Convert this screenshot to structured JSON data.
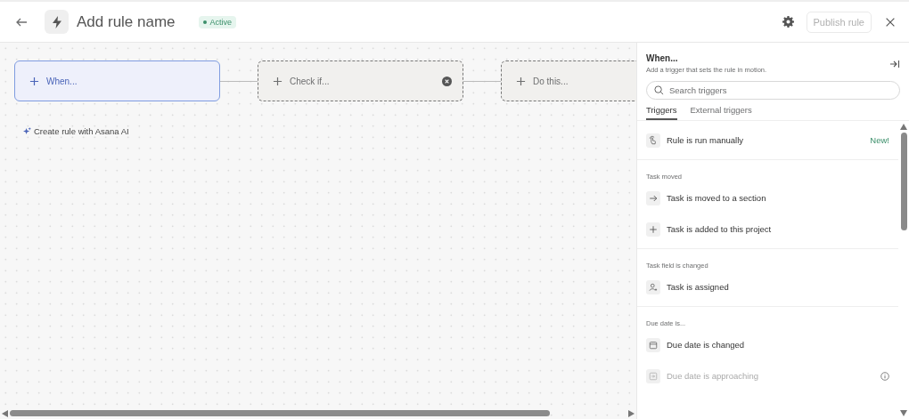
{
  "header": {
    "title": "Add rule name",
    "status": "Active",
    "publish_button": {
      "label": "Publish rule",
      "disabled": true
    }
  },
  "canvas": {
    "nodes": [
      {
        "label": "When...",
        "selected": true,
        "removable": false
      },
      {
        "label": "Check if...",
        "selected": false,
        "removable": true
      },
      {
        "label": "Do this...",
        "selected": false
      }
    ],
    "ai_link": "Create rule with Asana AI"
  },
  "panel": {
    "title": "When...",
    "subtitle": "Add a trigger that sets the rule in motion.",
    "search": {
      "placeholder": "Search triggers"
    },
    "tabs": [
      {
        "label": "Triggers",
        "selected": true
      },
      {
        "label": "External triggers",
        "selected": false
      }
    ],
    "sections": [
      {
        "items": [
          {
            "label": "Rule is run manually",
            "kind": "hand",
            "badge": "New!",
            "disabled": false
          }
        ]
      },
      {
        "heading": "Task moved",
        "items": [
          {
            "label": "Task is moved to a section",
            "kind": "arrow",
            "disabled": false
          },
          {
            "label": "Task is added to this project",
            "kind": "plus",
            "disabled": false
          }
        ]
      },
      {
        "heading": "Task field is changed",
        "items": [
          {
            "label": "Task is assigned",
            "kind": "person",
            "disabled": false
          }
        ]
      },
      {
        "heading": "Due date is...",
        "items": [
          {
            "label": "Due date is changed",
            "kind": "calendar",
            "disabled": false
          },
          {
            "label": "Due date is approaching",
            "kind": "calendar-arrow",
            "disabled": true,
            "info": true
          }
        ]
      }
    ]
  }
}
